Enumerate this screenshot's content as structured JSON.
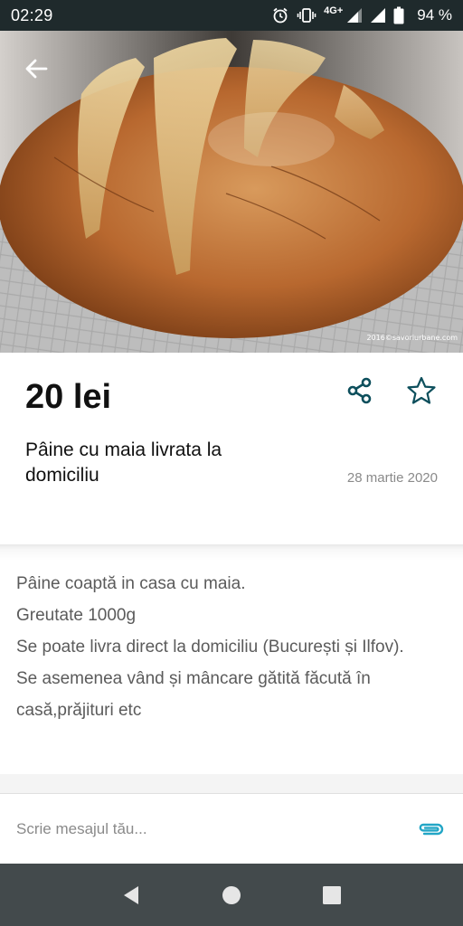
{
  "status_bar": {
    "time": "02:29",
    "network": "4G+",
    "battery": "94 %",
    "icons": [
      "alarm-icon",
      "vibrate-icon",
      "signal-icon",
      "signal-icon",
      "battery-icon"
    ]
  },
  "hero": {
    "watermark": "2016©savoriurbane.com",
    "back_icon": "arrow-left-icon"
  },
  "listing": {
    "price": "20 lei",
    "title": "Pâine cu maia livrata la domiciliu",
    "date": "28 martie 2020",
    "share_icon": "share-icon",
    "favorite_icon": "star-outline-icon",
    "accent_color": "#0d4f5c"
  },
  "description": {
    "lines": [
      "Pâine coaptă in casa cu maia.",
      "Greutate 1000g",
      "Se poate livra direct la domiciliu (București și Ilfov).",
      "Se asemenea vând și mâncare gătită făcută în casă,prăjituri etc"
    ]
  },
  "message": {
    "placeholder": "Scrie mesajul tău...",
    "attach_icon": "paperclip-icon",
    "attach_color": "#23a6c6"
  },
  "nav_bar": {
    "items": [
      "back-triangle-icon",
      "home-circle-icon",
      "recents-square-icon"
    ]
  }
}
